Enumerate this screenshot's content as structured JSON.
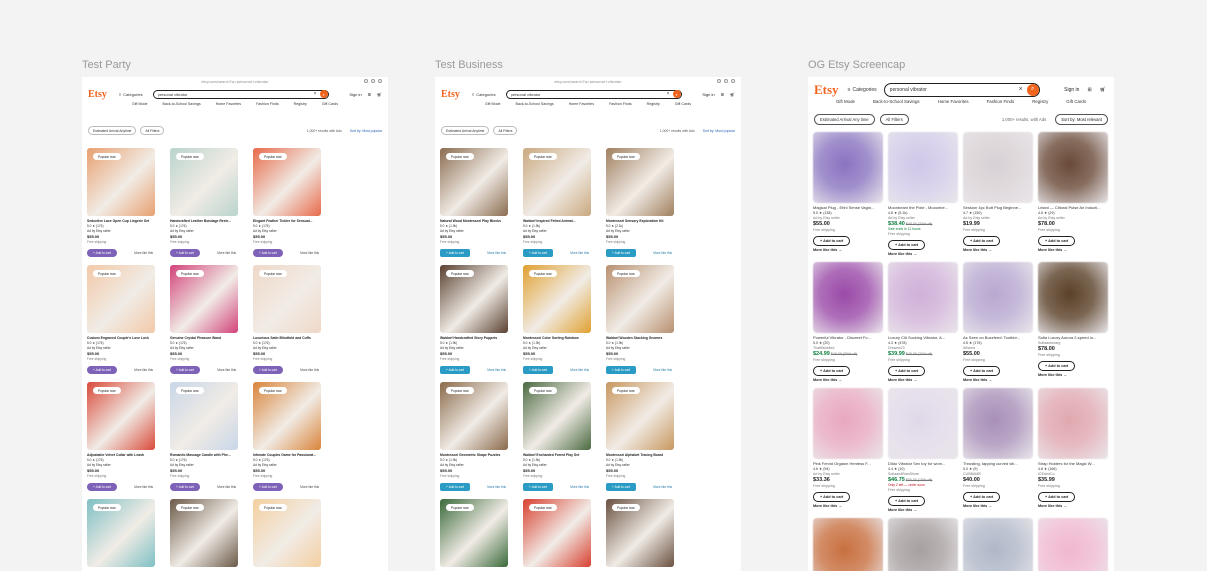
{
  "frames": {
    "f1": {
      "label": "Test Party"
    },
    "f2": {
      "label": "Test Business"
    },
    "f3": {
      "label": "OG Etsy Screencap"
    }
  },
  "small_header": {
    "url": "etsy.com/search?q=personal+vibrator",
    "logo": "Etsy",
    "categories": "Categories",
    "search_value": "personal vibrator",
    "sign_in": "Sign in",
    "nav": [
      "Gift Mode",
      "Back-to-School Savings",
      "Home Favorites",
      "Fashion Finds",
      "Registry",
      "Gift Cards"
    ],
    "filter_arrival": "Estimated Arrival  Anytime",
    "filter_all": "All Filters",
    "results": "1,000+ results with Ads",
    "sort": "Sort by: Most popular"
  },
  "party_cards": [
    {
      "badge": "Popular now",
      "title": "Seductive Lace Open Cup Lingerie Set",
      "rating": "5.0 ★ (176)",
      "seller": "Ad by Etsy seller",
      "price": "$55.00",
      "ship": "Free shipping",
      "add": "Add to cart",
      "more": "More like this"
    },
    {
      "badge": "Popular now",
      "title": "Handcrafted Leather Bondage Restr...",
      "rating": "5.0 ★ (176)",
      "seller": "Ad by Etsy seller",
      "price": "$55.00",
      "ship": "Free shipping",
      "add": "Add to cart",
      "more": "More like this"
    },
    {
      "badge": "Popular now",
      "title": "Elegant Feather Tickler for Sensual...",
      "rating": "5.0 ★ (176)",
      "seller": "Ad by Etsy seller",
      "price": "$55.00",
      "ship": "Free shipping",
      "add": "Add to cart",
      "more": "More like this"
    },
    {
      "badge": "Popular now",
      "title": "Custom Engraved Couple's Love Lock",
      "rating": "5.0 ★ (176)",
      "seller": "Ad by Etsy seller",
      "price": "$55.00",
      "ship": "Free shipping",
      "add": "Add to cart",
      "more": "More like this"
    },
    {
      "badge": "Popular now",
      "title": "Genuine Crystal Pleasure Wand",
      "rating": "5.0 ★ (176)",
      "seller": "Ad by Etsy seller",
      "price": "$55.00",
      "ship": "Free shipping",
      "add": "Add to cart",
      "more": "More like this"
    },
    {
      "badge": "Popular now",
      "title": "Luxurious Satin Blindfold and Cuffs",
      "rating": "5.0 ★ (176)",
      "seller": "Ad by Etsy seller",
      "price": "$55.00",
      "ship": "Free shipping",
      "add": "Add to cart",
      "more": "More like this"
    },
    {
      "badge": "Popular now",
      "title": "Adjustable Velvet Collar with Leash",
      "rating": "5.0 ★ (176)",
      "seller": "Ad by Etsy seller",
      "price": "$55.00",
      "ship": "Free shipping",
      "add": "Add to cart",
      "more": "More like this"
    },
    {
      "badge": "Popular now",
      "title": "Romantic Massage Candle with Phe...",
      "rating": "5.0 ★ (176)",
      "seller": "Ad by Etsy seller",
      "price": "$55.00",
      "ship": "Free shipping",
      "add": "Add to cart",
      "more": "More like this"
    },
    {
      "badge": "Popular now",
      "title": "Intimate Couples Game for Passionat...",
      "rating": "5.0 ★ (176)",
      "seller": "Ad by Etsy seller",
      "price": "$55.00",
      "ship": "Free shipping",
      "add": "Add to cart",
      "more": "More like this"
    },
    {
      "badge": "Popular now",
      "title": "",
      "rating": "",
      "seller": "",
      "price": "",
      "ship": "",
      "add": "",
      "more": ""
    },
    {
      "badge": "Popular now",
      "title": "",
      "rating": "",
      "seller": "",
      "price": "",
      "ship": "",
      "add": "",
      "more": ""
    },
    {
      "badge": "Popular now",
      "title": "",
      "rating": "",
      "seller": "",
      "price": "",
      "ship": "",
      "add": "",
      "more": ""
    }
  ],
  "business_cards": [
    {
      "badge": "Popular now",
      "title": "Natural Wood Montessori Play Blocks",
      "rating": "5.0 ★ (1.9k)",
      "seller": "Ad by Etsy seller",
      "price": "$55.00",
      "ship": "Free shipping",
      "add": "Add to cart",
      "more": "More like this"
    },
    {
      "badge": "Popular now",
      "title": "Waldorf Inspired Felted Animal...",
      "rating": "5.0 ★ (1.9k)",
      "seller": "Ad by Etsy seller",
      "price": "$55.00",
      "ship": "Free shipping",
      "add": "Add to cart",
      "more": "More like this"
    },
    {
      "badge": "Popular now",
      "title": "Montessori Sensory Exploration Kit",
      "rating": "5.0 ★ (2.1k)",
      "seller": "Ad by Etsy seller",
      "price": "$55.00",
      "ship": "Free shipping",
      "add": "Add to cart",
      "more": "More like this"
    },
    {
      "badge": "Popular now",
      "title": "Waldorf Handcrafted Story Puppets",
      "rating": "5.0 ★ (1.9k)",
      "seller": "Ad by Etsy seller",
      "price": "$55.00",
      "ship": "Free shipping",
      "add": "Add to cart",
      "more": "More like this"
    },
    {
      "badge": "Popular now",
      "title": "Montessori Color Sorting Rainbow",
      "rating": "5.0 ★ (1.9k)",
      "seller": "Ad by Etsy seller",
      "price": "$55.00",
      "ship": "Free shipping",
      "add": "Add to cart",
      "more": "More like this"
    },
    {
      "badge": "Popular now",
      "title": "Waldorf Wooden Stacking Gnomes",
      "rating": "5.0 ★ (1.9k)",
      "seller": "Ad by Etsy seller",
      "price": "$55.00",
      "ship": "Free shipping",
      "add": "Add to cart",
      "more": "More like this"
    },
    {
      "badge": "Popular now",
      "title": "Montessori Geometric Shape Puzzles",
      "rating": "5.0 ★ (1.9k)",
      "seller": "Ad by Etsy seller",
      "price": "$55.00",
      "ship": "Free shipping",
      "add": "Add to cart",
      "more": "More like this"
    },
    {
      "badge": "Popular now",
      "title": "Waldorf Enchanted Forest Play Set",
      "rating": "5.0 ★ (1.9k)",
      "seller": "Ad by Etsy seller",
      "price": "$55.00",
      "ship": "Free shipping",
      "add": "Add to cart",
      "more": "More like this"
    },
    {
      "badge": "Popular now",
      "title": "Montessori Alphabet Tracing Board",
      "rating": "5.0 ★ (1.9k)",
      "seller": "Ad by Etsy seller",
      "price": "$55.00",
      "ship": "Free shipping",
      "add": "Add to cart",
      "more": "More like this"
    },
    {
      "badge": "Popular now",
      "title": "",
      "rating": "",
      "seller": "",
      "price": "",
      "ship": "",
      "add": "",
      "more": ""
    },
    {
      "badge": "Popular now",
      "title": "",
      "rating": "",
      "seller": "",
      "price": "",
      "ship": "",
      "add": "",
      "more": ""
    },
    {
      "badge": "Popular now",
      "title": "",
      "rating": "",
      "seller": "",
      "price": "",
      "ship": "",
      "add": "",
      "more": ""
    }
  ],
  "og_header": {
    "logo": "Etsy",
    "categories": "Categories",
    "search_value": "personal vibrator",
    "sign_in": "Sign in",
    "nav": [
      "Gift Mode",
      "Back-to-School Savings",
      "Home Favorites",
      "Fashion Finds",
      "Registry",
      "Gift Cards"
    ],
    "filter_arrival": "Estimated Arrival  Any time",
    "filter_all": "All Filters",
    "results": "1,000+ results, with Ads",
    "sort": "Sort by: Most relevant"
  },
  "og_cards": [
    {
      "title": "Magical Plug - Ehhi Sense Vagin...",
      "rating": "5.0 ★ (138)",
      "seller": "Ad by Etsy seller",
      "price": "$55.00",
      "orig": "",
      "saletag": "",
      "ship": "Free shipping",
      "add": "Add to cart",
      "more": "More like this →"
    },
    {
      "title": "Moonbeam the Pixie - Mooonbe...",
      "rating": "4.8 ★ (5.1k)",
      "seller": "Ad by Etsy seller",
      "price": "$38.40",
      "orig": "$48.00 (20% off)",
      "saletag": "Sale ends in 11 hours",
      "ship": "Free shipping",
      "add": "Add to cart",
      "more": "More like this →"
    },
    {
      "title": "Session 4pc Butt Plug Beginne...",
      "rating": "4.7 ★ (150)",
      "seller": "Ad by Etsy seller",
      "price": "$19.99",
      "orig": "",
      "saletag": "",
      "ship": "Free shipping",
      "add": "Add to cart",
      "more": "More like this →"
    },
    {
      "title": "Lelani — Clitoral Pulse Air Inducti...",
      "rating": "4.6 ★ (29)",
      "seller": "Ad by Etsy seller",
      "price": "$78.00",
      "orig": "",
      "saletag": "",
      "ship": "Free shipping",
      "add": "Add to cart",
      "more": "More like this →"
    },
    {
      "title": "Powerful Vibrator - Discreet Fo...",
      "rating": "5.0 ★ (20)",
      "seller": "Thatflisbelted",
      "price": "$24.99",
      "orig": "$49.99 (50% off)",
      "saletag": "",
      "ship": "Free shipping",
      "add": "Add to cart",
      "more": "More like this →"
    },
    {
      "title": "Luxury Clit Sucking Vibrator, A...",
      "rating": "4.3 ★ (478)",
      "seller": "Dreams23",
      "price": "$39.99",
      "orig": "$49.99 (20% off)",
      "saletag": "",
      "ship": "Free shipping",
      "add": "Add to cart",
      "more": "More like this →"
    },
    {
      "title": "As Seen on Buzzfeed: Toothbr...",
      "rating": "4.6 ★ (176)",
      "seller": "Wiserrs",
      "price": "$55.00",
      "orig": "",
      "saletag": "",
      "ship": "Free shipping",
      "add": "Add to cart",
      "more": "More like this →"
    },
    {
      "title": "Sofia Luxury Aurora 2-speed in...",
      "rating": "",
      "seller": "Sofiaantonarg",
      "price": "$78.00",
      "orig": "",
      "saletag": "",
      "ship": "Free shipping",
      "add": "Add to cart",
      "more": "More like this →"
    },
    {
      "title": "Pink Fervid Orgasm Hentess F...",
      "rating": "4.6 ★ (94)",
      "seller": "Ad by Etsy seller",
      "price": "$33.36",
      "orig": "",
      "saletag": "",
      "ship": "Free shipping",
      "add": "Add to cart",
      "more": "More like this →"
    },
    {
      "title": "Dildo Vibrator Sex toy for wom...",
      "rating": "4.4 ★ (10)",
      "seller": "SofiaandRainShore",
      "price": "$46.75",
      "orig": "$55.00 (15% off)",
      "saletag": "Only 2 left — order soon",
      "ship": "Free shipping",
      "add": "Add to cart",
      "more": "More like this →"
    },
    {
      "title": "Thrusting, tapping curved vib...",
      "rating": "5.0 ★ (9)",
      "seller": "CUBBAMB",
      "price": "$40.00",
      "orig": "",
      "saletag": "",
      "ship": "Free shipping",
      "add": "Add to cart",
      "more": "More like this →"
    },
    {
      "title": "Strap Holders for the Magic W...",
      "rating": "4.8 ★ (166)",
      "seller": "ICEandCo",
      "price": "$35.99",
      "orig": "",
      "saletag": "",
      "ship": "Free shipping",
      "add": "Add to cart",
      "more": "More like this →"
    },
    {
      "title": "",
      "rating": "",
      "seller": "",
      "price": "",
      "orig": "",
      "saletag": "",
      "ship": "",
      "add": "",
      "more": ""
    },
    {
      "title": "",
      "rating": "",
      "seller": "",
      "price": "",
      "orig": "",
      "saletag": "",
      "ship": "",
      "add": "",
      "more": ""
    },
    {
      "title": "",
      "rating": "",
      "seller": "",
      "price": "",
      "orig": "",
      "saletag": "",
      "ship": "",
      "add": "",
      "more": ""
    },
    {
      "title": "",
      "rating": "",
      "seller": "",
      "price": "",
      "orig": "",
      "saletag": "",
      "ship": "",
      "add": "",
      "more": ""
    }
  ],
  "colors": {
    "brand": "#f1641e",
    "party_button": "#7d62b8",
    "business_button": "#2a9bc4",
    "sale_green": "#0a7d3c"
  },
  "images": {
    "party": [
      "#e8a070",
      "#b9d4cc",
      "#e86a4a",
      "#f2c9a8",
      "#d2427a",
      "#f0d8c8",
      "#d94a3a",
      "#c8d6e8",
      "#d9843a",
      "#7ec0c4",
      "#6b5a48",
      "#f4cfa0"
    ],
    "business": [
      "#8a6c50",
      "#c9a980",
      "#a08060",
      "#5a4030",
      "#e0a030",
      "#b89070",
      "#8a6a4a",
      "#4a6a40",
      "#c89860",
      "#3a6a3a",
      "#d84030",
      "#6a5040"
    ],
    "og": [
      "#8a74c0",
      "#cfc8e8",
      "#d8d0d4",
      "#6a4a38",
      "#9a4aa8",
      "#d0b0d8",
      "#b8a8d0",
      "#5a4028",
      "#e8a8c0",
      "#e0d8e8",
      "#a890b8",
      "#e0a8b0",
      "#c87040",
      "#a8a0a0",
      "#b0b8c8",
      "#f0b8d0"
    ]
  }
}
